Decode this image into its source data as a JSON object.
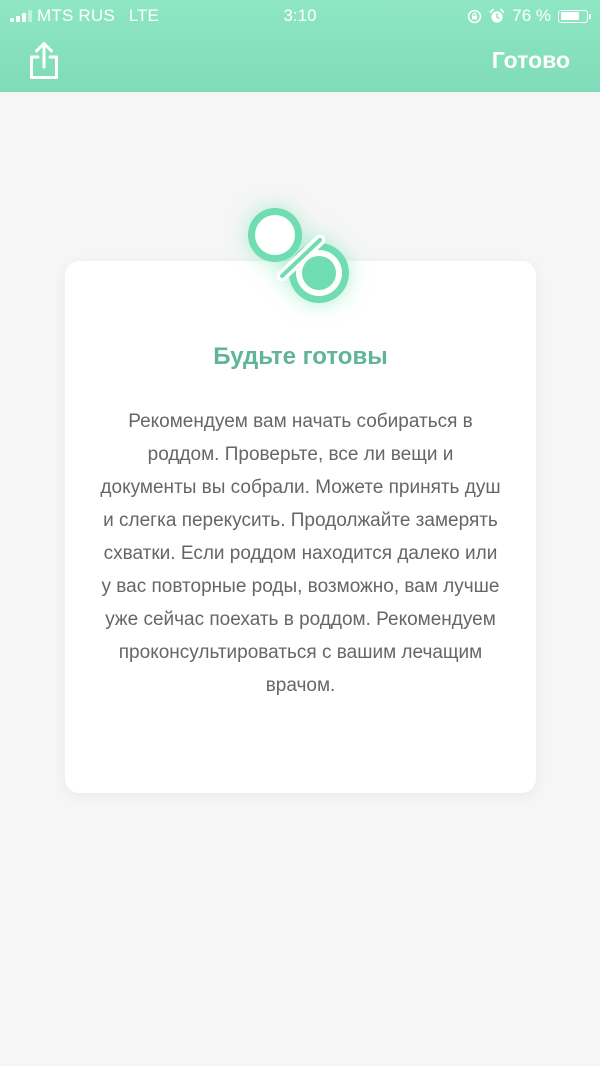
{
  "status_bar": {
    "carrier": "MTS RUS",
    "network": "LTE",
    "time": "3:10",
    "battery_text": "76 %",
    "battery_level": 0.76,
    "signal_bars": 3
  },
  "header": {
    "share_icon": "share-icon",
    "done_label": "Готово"
  },
  "card": {
    "icon": "pacifier-icon",
    "title": "Будьте готовы",
    "body": "Рекомендуем вам начать собираться в роддом. Проверьте, все ли вещи и документы вы собрали. Можете принять душ и слегка перекусить. Продолжайте замерять схватки. Если роддом находится далеко или у вас повторные роды, возможно, вам лучше уже сейчас поехать в роддом. Рекомендуем проконсультироваться с вашим лечащим врачом."
  },
  "colors": {
    "header_top": "#8fe7c4",
    "header_bottom": "#7fdbb8",
    "accent": "#5fb596",
    "icon_green": "#6fdcb2",
    "background": "#f6f6f6"
  }
}
